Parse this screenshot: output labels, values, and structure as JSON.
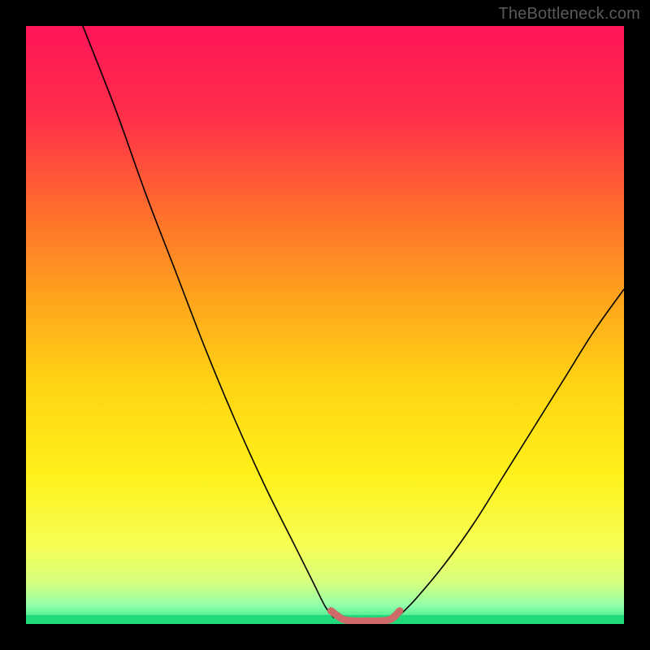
{
  "watermark": "TheBottleneck.com",
  "chart_data": {
    "type": "line",
    "title": "",
    "xlabel": "",
    "ylabel": "",
    "xlim": [
      0,
      100
    ],
    "ylim": [
      0,
      100
    ],
    "annotations": [],
    "series": [
      {
        "name": "bottleneck-curve-left",
        "color": "#000000",
        "x": [
          9.5,
          15,
          20,
          25,
          30,
          35,
          40,
          45,
          48,
          50,
          51.5
        ],
        "y": [
          100,
          86,
          72,
          59,
          46,
          34,
          23,
          13,
          7,
          3,
          1
        ]
      },
      {
        "name": "bottleneck-curve-right",
        "color": "#000000",
        "x": [
          62,
          65,
          70,
          75,
          80,
          85,
          90,
          95,
          100
        ],
        "y": [
          1,
          4,
          10,
          17,
          25,
          33,
          41,
          49,
          56
        ]
      },
      {
        "name": "bottleneck-flat-marker",
        "color": "#cf6a6a",
        "x": [
          51,
          53,
          55,
          57,
          59,
          61,
          62.5
        ],
        "y": [
          2.2,
          0.8,
          0.5,
          0.5,
          0.5,
          0.8,
          2.2
        ]
      }
    ],
    "gradient_band": {
      "top_pct": 0,
      "bottom_pct": 100,
      "colors": [
        {
          "stop": 0.0,
          "hex": "#ff1558"
        },
        {
          "stop": 0.15,
          "hex": "#ff2e4a"
        },
        {
          "stop": 0.3,
          "hex": "#ff6a2e"
        },
        {
          "stop": 0.45,
          "hex": "#ffa21d"
        },
        {
          "stop": 0.6,
          "hex": "#ffd413"
        },
        {
          "stop": 0.75,
          "hex": "#fff11a"
        },
        {
          "stop": 0.87,
          "hex": "#f6ff55"
        },
        {
          "stop": 0.93,
          "hex": "#d6ff7e"
        },
        {
          "stop": 0.97,
          "hex": "#8fffaa"
        },
        {
          "stop": 1.0,
          "hex": "#24e07e"
        }
      ]
    },
    "green_strip": {
      "y_start": 1.5,
      "y_end": 0,
      "color": "#1fd97a"
    }
  }
}
